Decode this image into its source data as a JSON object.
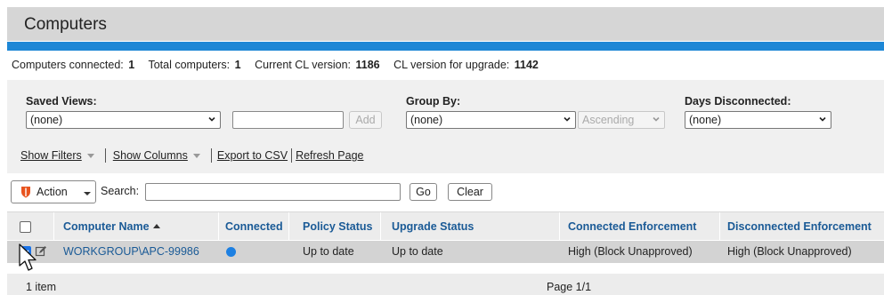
{
  "header": {
    "title": "Computers"
  },
  "stats": {
    "connected_label": "Computers connected:",
    "connected_value": "1",
    "total_label": "Total computers:",
    "total_value": "1",
    "current_cl_label": "Current CL version:",
    "current_cl_value": "1186",
    "upgrade_cl_label": "CL version for upgrade:",
    "upgrade_cl_value": "1142"
  },
  "filters": {
    "saved_views": {
      "label": "Saved Views:",
      "value": "(none)"
    },
    "view_name_input": {
      "value": ""
    },
    "add_label": "Add",
    "group_by": {
      "label": "Group By:",
      "value": "(none)"
    },
    "order": {
      "value": "Ascending"
    },
    "days_disconnected": {
      "label": "Days Disconnected:",
      "value": "(none)"
    }
  },
  "links": {
    "show_filters": "Show Filters",
    "show_columns": "Show Columns",
    "export_csv": "Export to CSV",
    "refresh_page": "Refresh Page"
  },
  "toolbar": {
    "action_label": "Action",
    "search_label": "Search:",
    "search_value": "",
    "go_label": "Go",
    "clear_label": "Clear"
  },
  "table": {
    "columns": [
      "Computer Name",
      "Connected",
      "Policy Status",
      "Upgrade Status",
      "Connected Enforcement",
      "Disconnected Enforcement"
    ],
    "rows": [
      {
        "checked": true,
        "computer_name": "WORKGROUP\\APC-99986",
        "connected": "connected",
        "policy_status": "Up to date",
        "upgrade_status": "Up to date",
        "connected_enforcement": "High (Block Unapproved)",
        "disconnected_enforcement": "High (Block Unapproved)"
      }
    ]
  },
  "footer": {
    "count": "1 item",
    "page": "Page 1/1"
  },
  "colors": {
    "accent": "#1d87d6",
    "link": "#1a5a96",
    "connected_dot": "#1d80e2",
    "shield": "#e8541f"
  }
}
